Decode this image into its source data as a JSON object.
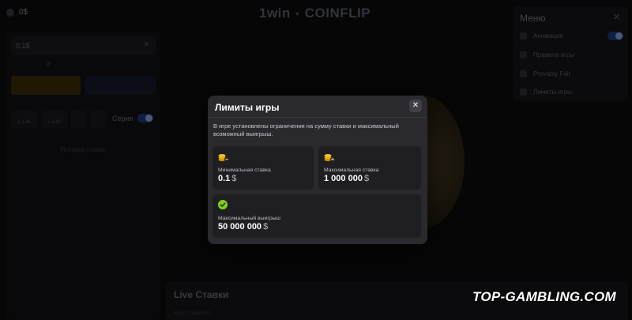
{
  "header": {
    "balance": "0$",
    "brand": "1win",
    "game": "COINFLIP"
  },
  "left_panel": {
    "bet_value": "0.1$",
    "bet_clear": "✕",
    "multiplier": "0",
    "chips": [
      "x 1.96",
      "x 3.92",
      "",
      ""
    ],
    "series_label": "Серия",
    "caption": "История ставок"
  },
  "menu": {
    "title": "Меню",
    "close": "✕",
    "items": [
      {
        "label": "Анимация"
      },
      {
        "label": "Правила игры"
      },
      {
        "label": "Provably Fair"
      },
      {
        "label": "Лимиты игры"
      }
    ]
  },
  "live": {
    "title": "Live Ставки",
    "subtitle": "Все | Ставки 100"
  },
  "watermark": "TOP-GAMBLING.COM",
  "modal": {
    "title": "Лимиты игры",
    "close": "✕",
    "description": "В игре установлены ограничения на сумму ставки и максимальный возможный выигрыш.",
    "cards": {
      "min_bet": {
        "label": "Минимальная ставка",
        "value": "0.1",
        "currency": "$"
      },
      "max_bet": {
        "label": "Максимальная ставка",
        "value": "1 000 000",
        "currency": "$"
      },
      "max_win": {
        "label": "Максимальный выигрыш",
        "value": "50 000 000",
        "currency": "$"
      }
    }
  },
  "colors": {
    "accent_gold": "#f0b90b",
    "accent_green": "#7ccf22",
    "modal_bg": "#2a2a2e",
    "card_bg": "#1f1f23"
  }
}
